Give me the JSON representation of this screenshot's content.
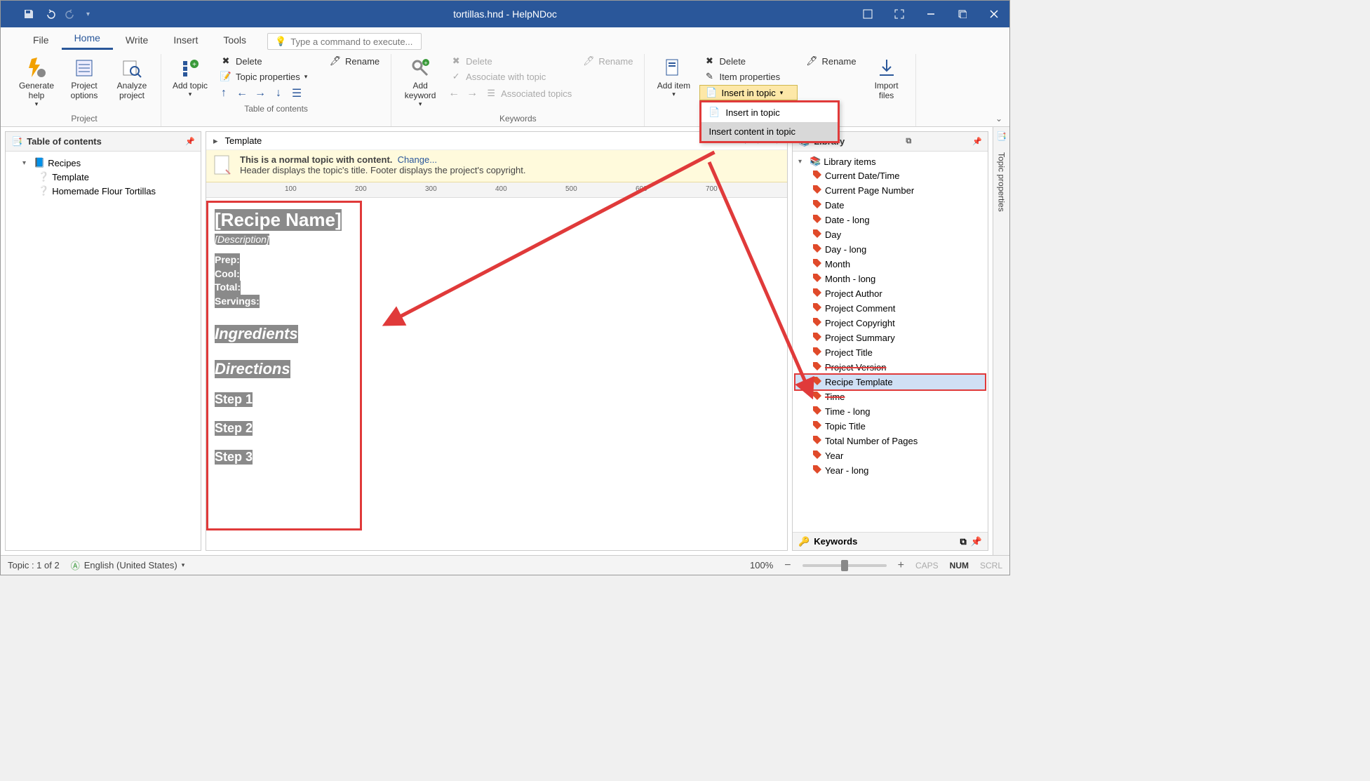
{
  "titlebar": {
    "title": "tortillas.hnd - HelpNDoc"
  },
  "tabs": {
    "file": "File",
    "home": "Home",
    "write": "Write",
    "insert": "Insert",
    "tools": "Tools"
  },
  "search": {
    "placeholder": "Type a command to execute..."
  },
  "ribbon": {
    "project": {
      "label": "Project",
      "generate": "Generate help",
      "options": "Project options",
      "analyze": "Analyze project"
    },
    "toc": {
      "label": "Table of contents",
      "add_topic": "Add topic",
      "delete": "Delete",
      "rename": "Rename",
      "topic_props": "Topic properties"
    },
    "keywords": {
      "label": "Keywords",
      "add_keyword": "Add keyword",
      "delete": "Delete",
      "rename": "Rename",
      "associate": "Associate with topic",
      "associated": "Associated topics"
    },
    "library": {
      "add_item": "Add item",
      "delete": "Delete",
      "rename": "Rename",
      "item_props": "Item properties",
      "insert_in_topic": "Insert in topic",
      "menu_insert": "Insert in topic",
      "menu_insert_content": "Insert content in topic",
      "import": "Import files"
    }
  },
  "toc_panel": {
    "title": "Table of contents",
    "root": "Recipes",
    "item1": "Template",
    "item2": "Homemade Flour Tortillas"
  },
  "editor": {
    "breadcrumb": "Template",
    "banner_strong": "This is a normal topic with content.",
    "banner_change": "Change...",
    "banner_line2": "Header displays the topic's title.   Footer displays the project's copyright.",
    "ruler_ticks": [
      "100",
      "200",
      "300",
      "400",
      "500",
      "600",
      "700"
    ],
    "recipe": {
      "name": "[Recipe Name]",
      "desc": "[Description]",
      "prep": "Prep",
      "cool": "Cool",
      "total": "Total",
      "servings": "Servings",
      "ingredients": "Ingredients",
      "directions": "Directions",
      "step1": "Step 1",
      "step2": "Step 2",
      "step3": "Step 3"
    }
  },
  "library_panel": {
    "title": "Library",
    "root": "Library items",
    "items": [
      "Current Date/Time",
      "Current Page Number",
      "Date",
      "Date - long",
      "Day",
      "Day - long",
      "Month",
      "Month - long",
      "Project Author",
      "Project Comment",
      "Project Copyright",
      "Project Summary",
      "Project Title",
      "Project Version",
      "Recipe Template",
      "Time",
      "Time - long",
      "Topic Title",
      "Total Number of Pages",
      "Year",
      "Year - long"
    ],
    "keywords_title": "Keywords"
  },
  "side": {
    "topic_props": "Topic properties"
  },
  "statusbar": {
    "topic": "Topic : 1 of 2",
    "lang": "English (United States)",
    "zoom": "100%",
    "caps": "CAPS",
    "num": "NUM",
    "scrl": "SCRL"
  }
}
